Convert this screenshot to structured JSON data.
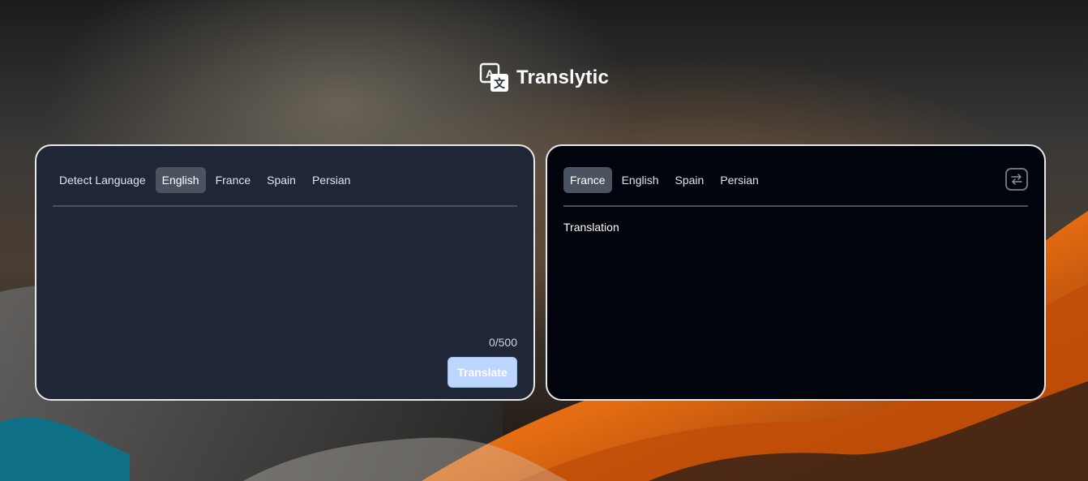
{
  "app": {
    "title": "Translytic",
    "icon": "translate-icon"
  },
  "source_panel": {
    "tabs": [
      {
        "label": "Detect Language",
        "active": false
      },
      {
        "label": "English",
        "active": true
      },
      {
        "label": "France",
        "active": false
      },
      {
        "label": "Spain",
        "active": false
      },
      {
        "label": "Persian",
        "active": false
      }
    ],
    "input_value": "",
    "char_count": "0/500",
    "translate_label": "Translate"
  },
  "target_panel": {
    "tabs": [
      {
        "label": "France",
        "active": true
      },
      {
        "label": "English",
        "active": false
      },
      {
        "label": "Spain",
        "active": false
      },
      {
        "label": "Persian",
        "active": false
      }
    ],
    "swap_icon": "swap-icon",
    "output_text": "Translation"
  },
  "colors": {
    "source_bg": "#1f2736",
    "target_bg": "#02040d",
    "active_tab": "#4b5260",
    "translate_button": "#bdd6ff"
  }
}
